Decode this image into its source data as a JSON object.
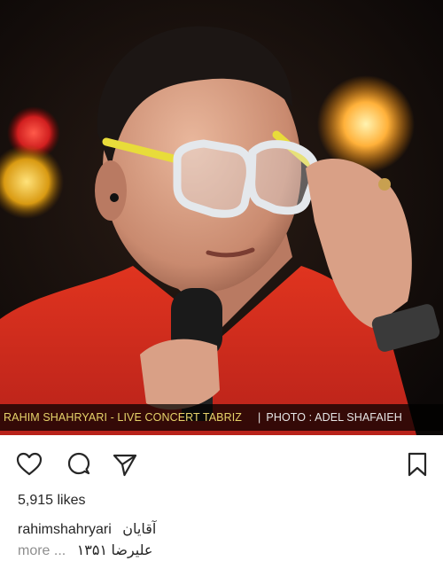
{
  "post": {
    "photo_caption_left": "RAHIM SHAHRYARI - LIVE CONCERT TABRIZ",
    "photo_caption_sep": "|",
    "photo_caption_right": "PHOTO : ADEL SHAFAIEH",
    "likes": "5,915 likes",
    "username": "rahimshahryari",
    "caption_text": "آقایان",
    "caption_more": "more ...",
    "caption_continued": "علیرضا ۱۳۵۱"
  },
  "icons": {
    "like": "heart-icon",
    "comment": "comment-icon",
    "share": "send-icon",
    "save": "bookmark-icon"
  },
  "colors": {
    "shirt": "#d62a1e",
    "glasses_frame": "#e8dc3a",
    "caption_accent": "#e6d36a",
    "text": "#262626",
    "muted": "#8e8e8e"
  }
}
